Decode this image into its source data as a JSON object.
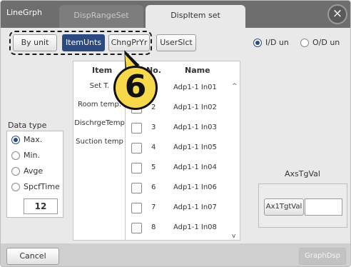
{
  "tabs": {
    "linegrph": "LineGrph",
    "disprange": "DispRangeSet",
    "dispitem": "DispItem set"
  },
  "close_icon": "×",
  "toolbar": {
    "by_unit": "By unit",
    "item_units": "ItemUnts",
    "chng_pr_yr": "ChngPrYr",
    "user_slct": "UserSlct",
    "selected": "ItemUnts"
  },
  "unit_radio": {
    "options": [
      "I/D un",
      "O/D un"
    ],
    "selected": "I/D un"
  },
  "data_type": {
    "title": "Data type",
    "options": [
      "Max.",
      "Min.",
      "Avge",
      "SpcfTime"
    ],
    "selected": "Max.",
    "spcf_value": "12"
  },
  "table": {
    "col_item": "Item",
    "col_no": "No.",
    "col_name": "Name",
    "items": [
      "Set T.",
      "Room temp.",
      "DischrgeTemp",
      "Suction temp"
    ],
    "rows": [
      {
        "no": "1",
        "name": "Adp1-1 In01"
      },
      {
        "no": "2",
        "name": "Adp1-1 In02"
      },
      {
        "no": "3",
        "name": "Adp1-1 In03"
      },
      {
        "no": "4",
        "name": "Adp1-1 In05"
      },
      {
        "no": "5",
        "name": "Adp1-1 In04"
      },
      {
        "no": "6",
        "name": "Adp1-1 In06"
      },
      {
        "no": "7",
        "name": "Adp1-1 In07"
      },
      {
        "no": "8",
        "name": "Adp1-1 In08"
      }
    ],
    "scroll_up": "^",
    "scroll_down": "v"
  },
  "axs": {
    "title": "AxsTgVal",
    "button": "Ax1TgtVal",
    "value": ""
  },
  "callout_number": "6",
  "footer": {
    "cancel": "Cancel",
    "graphdsp": "GraphDsp"
  },
  "colors": {
    "accent": "#2c4a7f",
    "tabbar": "#6e6e6e",
    "callout": "#f7d84b"
  }
}
